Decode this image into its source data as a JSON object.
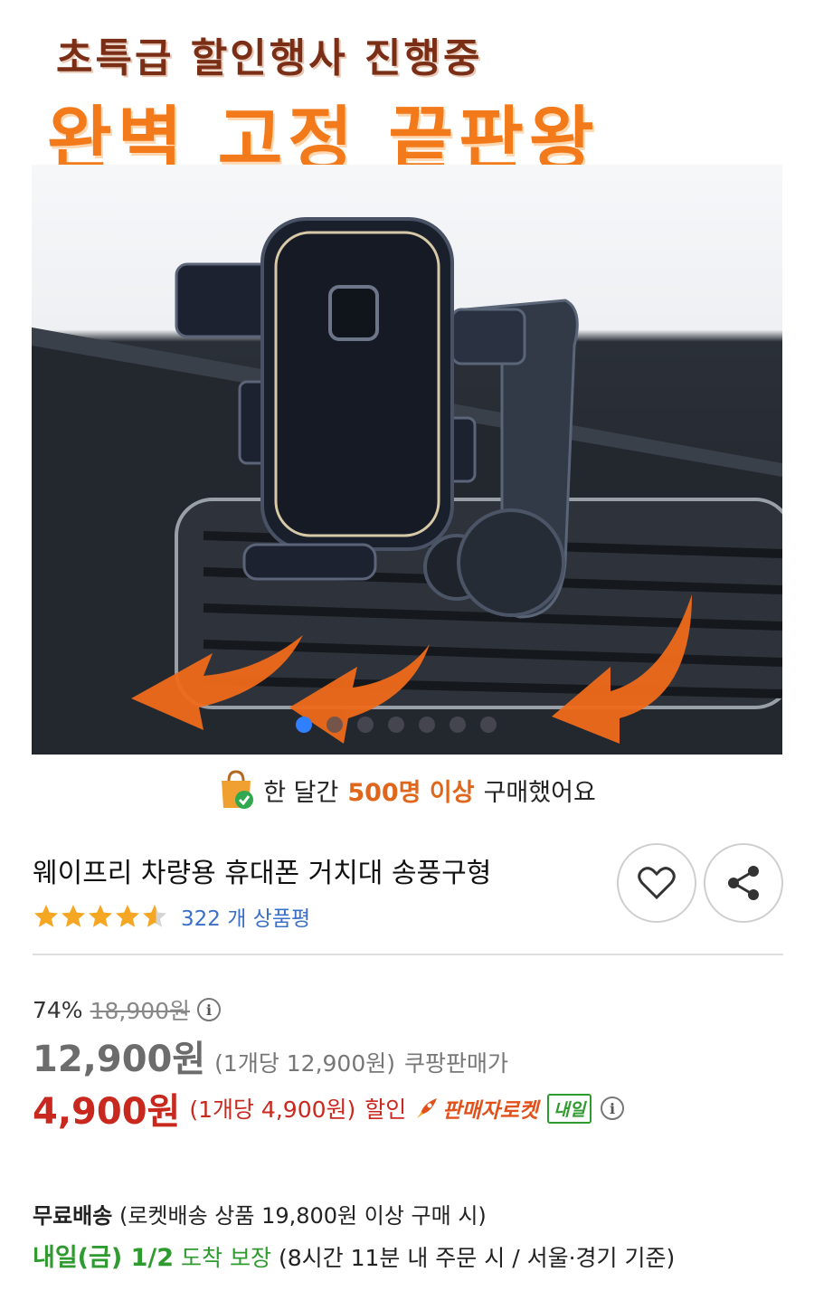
{
  "banner": {
    "line1": "초특급 할인행사 진행중",
    "line2": "완벽 고정 끝판왕"
  },
  "carousel": {
    "image_icon": "car-vent-phone-holder-photo",
    "slide_count": 7,
    "active_index": 0
  },
  "purchase_info": {
    "prefix": "한 달간",
    "highlight": "500명 이상",
    "suffix": "구매했어요"
  },
  "product": {
    "title": "웨이프리 차량용 휴대폰 거치대 송풍구형",
    "rating": 4.5,
    "review_count": "322 개 상품평"
  },
  "actions": {
    "wishlist_icon": "heart-icon",
    "share_icon": "share-icon"
  },
  "pricing": {
    "discount_percent": "74%",
    "original_price": "18,900원",
    "coupang_price": "12,900원",
    "coupang_unit": "(1개당 12,900원)",
    "coupang_label": "쿠팡판매가",
    "sale_price": "4,900원",
    "sale_unit": "(1개당 4,900원)",
    "sale_label": "할인",
    "rocket_label": "판매자로켓",
    "tomorrow_badge": "내일"
  },
  "shipping": {
    "free_label": "무료배송",
    "free_condition": "(로켓배송 상품 19,800원 이상 구매 시)",
    "arrival_date": "내일(금) 1/2",
    "arrival_label": "도착 보장",
    "arrival_condition": "(8시간 11분 내 주문 시 / 서울·경기 기준)"
  },
  "colors": {
    "accent_orange": "#f37a1b",
    "sale_red": "#c8281e",
    "rocket_green": "#2f9a2f",
    "link_blue": "#3a70c9",
    "carousel_active": "#2f7fff"
  }
}
